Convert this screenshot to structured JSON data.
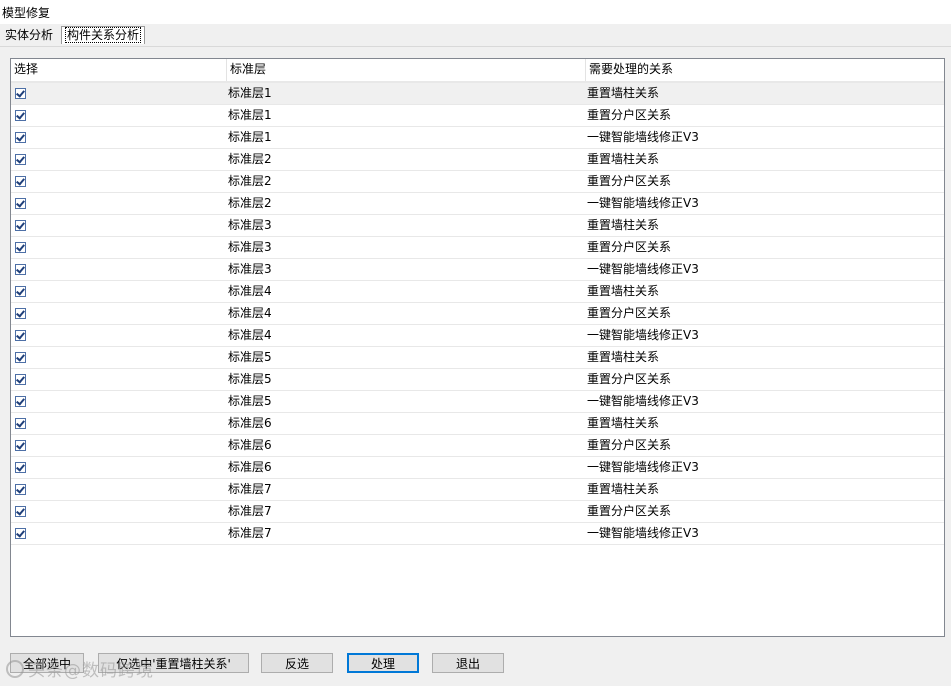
{
  "window": {
    "title": "模型修复"
  },
  "tabs": [
    {
      "label": "实体分析"
    },
    {
      "label": "构件关系分析"
    }
  ],
  "grid": {
    "columns": [
      "选择",
      "标准层",
      "需要处理的关系"
    ],
    "rows": [
      {
        "checked": true,
        "layer": "标准层1",
        "relation": "重置墙柱关系"
      },
      {
        "checked": true,
        "layer": "标准层1",
        "relation": "重置分户区关系"
      },
      {
        "checked": true,
        "layer": "标准层1",
        "relation": "一键智能墙线修正V3"
      },
      {
        "checked": true,
        "layer": "标准层2",
        "relation": "重置墙柱关系"
      },
      {
        "checked": true,
        "layer": "标准层2",
        "relation": "重置分户区关系"
      },
      {
        "checked": true,
        "layer": "标准层2",
        "relation": "一键智能墙线修正V3"
      },
      {
        "checked": true,
        "layer": "标准层3",
        "relation": "重置墙柱关系"
      },
      {
        "checked": true,
        "layer": "标准层3",
        "relation": "重置分户区关系"
      },
      {
        "checked": true,
        "layer": "标准层3",
        "relation": "一键智能墙线修正V3"
      },
      {
        "checked": true,
        "layer": "标准层4",
        "relation": "重置墙柱关系"
      },
      {
        "checked": true,
        "layer": "标准层4",
        "relation": "重置分户区关系"
      },
      {
        "checked": true,
        "layer": "标准层4",
        "relation": "一键智能墙线修正V3"
      },
      {
        "checked": true,
        "layer": "标准层5",
        "relation": "重置墙柱关系"
      },
      {
        "checked": true,
        "layer": "标准层5",
        "relation": "重置分户区关系"
      },
      {
        "checked": true,
        "layer": "标准层5",
        "relation": "一键智能墙线修正V3"
      },
      {
        "checked": true,
        "layer": "标准层6",
        "relation": "重置墙柱关系"
      },
      {
        "checked": true,
        "layer": "标准层6",
        "relation": "重置分户区关系"
      },
      {
        "checked": true,
        "layer": "标准层6",
        "relation": "一键智能墙线修正V3"
      },
      {
        "checked": true,
        "layer": "标准层7",
        "relation": "重置墙柱关系"
      },
      {
        "checked": true,
        "layer": "标准层7",
        "relation": "重置分户区关系"
      },
      {
        "checked": true,
        "layer": "标准层7",
        "relation": "一键智能墙线修正V3"
      }
    ]
  },
  "buttons": {
    "select_all": "全部选中",
    "select_wall_column": "仅选中'重置墙柱关系'",
    "invert": "反选",
    "process": "处理",
    "exit": "退出"
  },
  "watermark": {
    "text": "头条@数码跨境"
  },
  "colors": {
    "accent": "#0078d7",
    "border": "#828790"
  }
}
